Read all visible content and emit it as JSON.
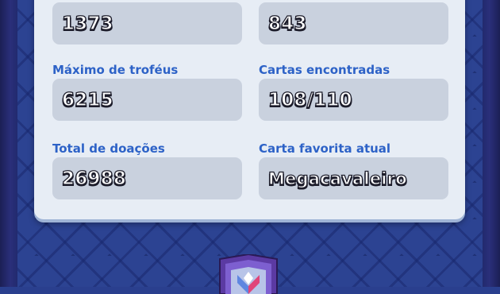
{
  "stats": [
    {
      "label": "",
      "value": "1373"
    },
    {
      "label": "",
      "value": "843"
    },
    {
      "label": "Máximo de troféus",
      "value": "6215"
    },
    {
      "label": "Cartas encontradas",
      "value": "108/110"
    },
    {
      "label": "Total de doações",
      "value": "26988"
    },
    {
      "label": "Carta favorita atual",
      "value": "Megacavaleiro"
    }
  ],
  "colors": {
    "panel": "#e7edf5",
    "label": "#2d62c7",
    "value_box": "#c9d1de",
    "background": "#2c4392"
  },
  "badge": {
    "icon": "arena-shield-icon"
  }
}
